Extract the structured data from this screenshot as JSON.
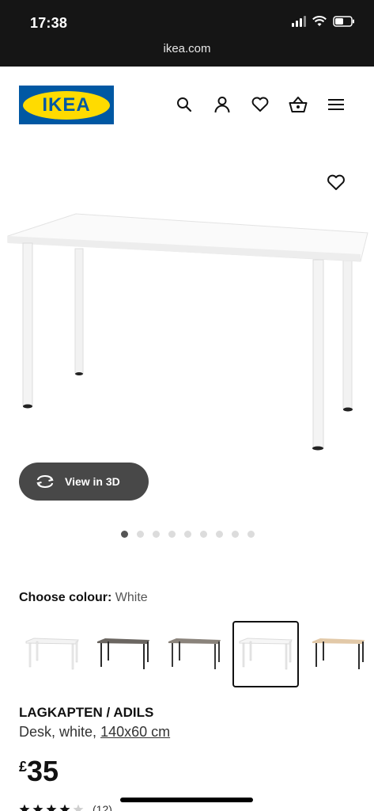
{
  "status_bar": {
    "time": "17:38"
  },
  "browser": {
    "url": "ikea.com"
  },
  "header": {
    "logo_text": "IKEA",
    "icons": [
      "search-icon",
      "user-icon",
      "heart-icon",
      "basket-icon",
      "menu-icon"
    ]
  },
  "product_image": {
    "favourite_icon": "heart-icon",
    "view3d_label": "View in 3D",
    "carousel": {
      "count": 9,
      "active": 1
    }
  },
  "colour": {
    "label": "Choose colour:",
    "value": "White"
  },
  "swatches": [
    {
      "name": "white-white",
      "top": "#f3f3f3",
      "legs": "#ececec"
    },
    {
      "name": "dark-grey-black",
      "top": "#6b6661",
      "legs": "#2b2b2b"
    },
    {
      "name": "grey-black",
      "top": "#8a837b",
      "legs": "#3a3a3a"
    },
    {
      "name": "white-selected",
      "top": "#f6f6f6",
      "legs": "#e8e8e8"
    },
    {
      "name": "birch-black",
      "top": "#e2c9a8",
      "legs": "#2e2e2e"
    }
  ],
  "product": {
    "name": "LAGKAPTEN / ADILS",
    "description": "Desk, white,",
    "size": "140x60 cm",
    "price_currency": "£",
    "price_value": "35",
    "reviews": "(12)",
    "rating": 4
  },
  "colors": {
    "brand_blue": "#0058a3",
    "brand_yellow": "#ffdb00"
  }
}
